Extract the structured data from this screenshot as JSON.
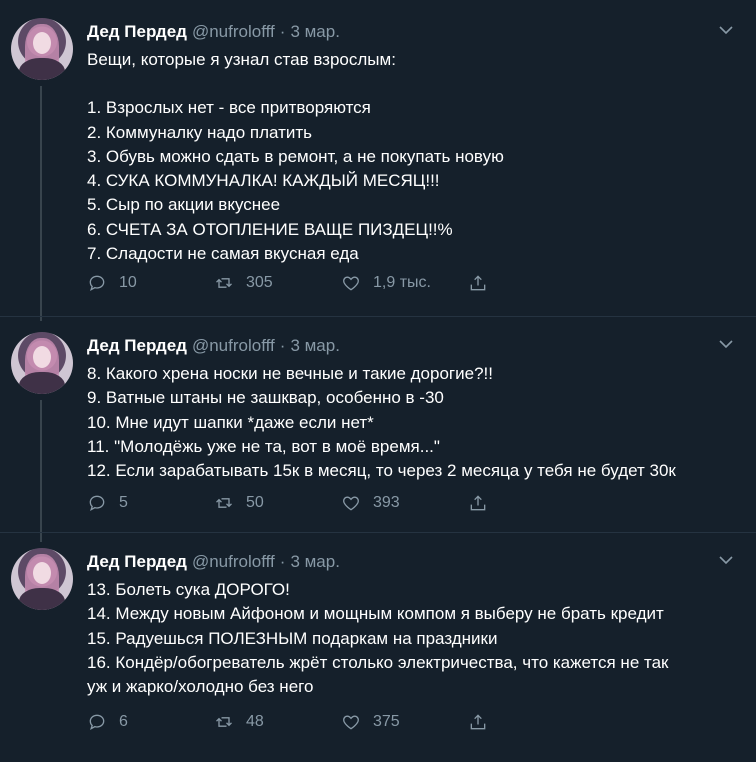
{
  "tweets": [
    {
      "author": {
        "name": "Дед Пердед",
        "handle": "@nufrolofff",
        "date": "3 мар."
      },
      "lines": [
        "Вещи, которые я узнал став взрослым:",
        "",
        "1. Взрослых нет - все притворяются",
        "2. Коммуналку надо платить",
        "3. Обувь можно сдать в ремонт, а не покупать новую",
        "4. СУКА КОММУНАЛКА! КАЖДЫЙ МЕСЯЦ!!!",
        "5. Сыр по акции вкуснее",
        "6. СЧЕТА ЗА ОТОПЛЕНИЕ ВАЩЕ ПИЗДЕЦ!!%",
        "7. Сладости не самая вкусная еда"
      ],
      "actions": {
        "replies": "10",
        "retweets": "305",
        "likes": "1,9 тыс."
      }
    },
    {
      "author": {
        "name": "Дед Пердед",
        "handle": "@nufrolofff",
        "date": "3 мар."
      },
      "lines": [
        "8. Какого хрена носки не вечные и такие дорогие?!!",
        "9. Ватные штаны не зашквар, особенно в -30",
        "10. Мне идут шапки *даже если нет*",
        "11. \"Молодёжь уже не та, вот в моё время...\"",
        "12. Если зарабатывать 15к в месяц, то через 2 месяца у тебя не будет 30к"
      ],
      "actions": {
        "replies": "5",
        "retweets": "50",
        "likes": "393"
      }
    },
    {
      "author": {
        "name": "Дед Пердед",
        "handle": "@nufrolofff",
        "date": "3 мар."
      },
      "lines": [
        "13. Болеть сука ДОРОГО!",
        "14. Между новым Айфоном и мощным компом я выберу не брать кредит",
        "15. Радуешься ПОЛЕЗНЫМ подаркам на праздники",
        "16. Кондёр/обогреватель жрёт столько электричества, что кажется не так",
        "уж и жарко/холодно без него"
      ],
      "actions": {
        "replies": "6",
        "retweets": "48",
        "likes": "375"
      }
    }
  ],
  "icons": {
    "reply": "reply-icon",
    "retweet": "retweet-icon",
    "like": "heart-icon",
    "share": "share-icon",
    "menu": "chevron-down-icon"
  },
  "colors": {
    "background": "#15202b",
    "text": "#ffffff",
    "secondary": "#8899a6",
    "divider": "#253341"
  }
}
